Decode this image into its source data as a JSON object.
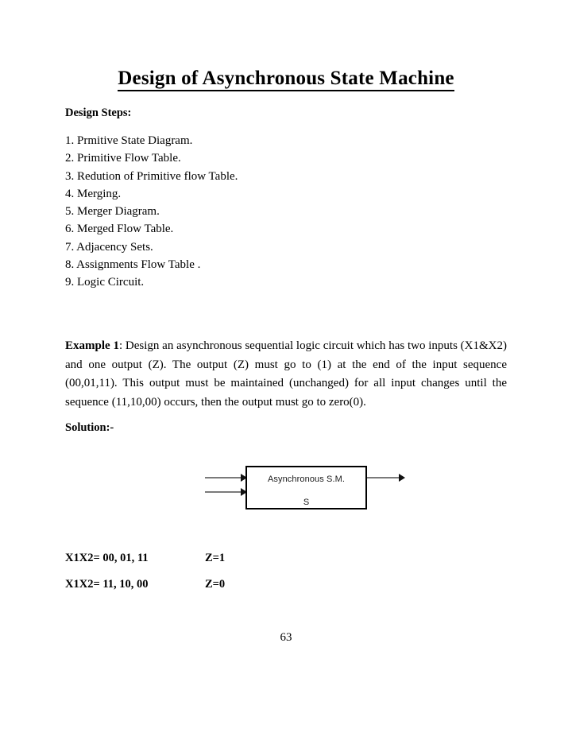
{
  "document": {
    "title": "Design of Asynchronous State Machine",
    "section_heading": "Design Steps:",
    "steps": [
      "1. Prmitive State Diagram.",
      "2. Primitive Flow Table.",
      "3. Redution of Primitive flow Table.",
      "4. Merging.",
      "5. Merger Diagram.",
      "6. Merged Flow Table.",
      "7. Adjacency Sets.",
      "8. Assignments Flow Table .",
      "9. Logic Circuit."
    ],
    "example": {
      "lead": "Example 1",
      "body": ": Design an asynchronous sequential logic circuit which has two inputs (X1&X2) and one output (Z). The output (Z) must go to (1) at the end of the input sequence (00,01,11). This output must be maintained (unchanged) for all input changes until the sequence (11,10,00) occurs, then the output must go to zero(0)."
    },
    "solution_label": "Solution:-",
    "diagram": {
      "box_label": "Asynchronous S.M.",
      "box_sub_label": "S",
      "line_color": "#7a7a7a",
      "arrow_color": "#111111",
      "border_color": "#000000"
    },
    "sequences": [
      {
        "inputs": "X1X2= 00, 01, 11",
        "output": "Z=1"
      },
      {
        "inputs": "X1X2= 11, 10, 00",
        "output": "Z=0"
      }
    ],
    "page_number": "63"
  }
}
